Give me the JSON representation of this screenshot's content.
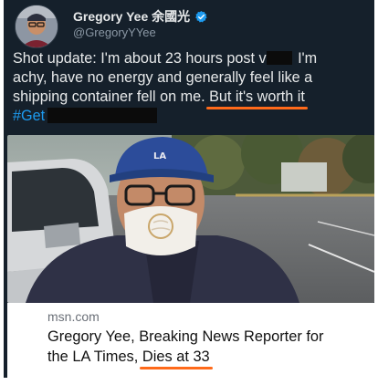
{
  "tweet": {
    "display_name": "Gregory Yee 余國光",
    "handle": "@GregoryYYee",
    "verified_icon": "verified-badge-icon",
    "text_lines": [
      "Shot update: I'm about 23 hours post v",
      "I'm",
      "achy, have no energy and generally feel like a",
      "shipping container fell on me.",
      "But it's worth it",
      "#Get"
    ]
  },
  "link_card": {
    "source": "msn.com",
    "title_line1": "Gregory Yee, Breaking News Reporter for",
    "title_line2_prefix": "the LA Times,",
    "title_line2_emphasis": "Dies at 33"
  },
  "colors": {
    "background": "#15202b",
    "text": "#e7e9ea",
    "muted": "#8b98a5",
    "accent_blue": "#1d9bf0",
    "annotation_orange": "#ff6a1a"
  }
}
